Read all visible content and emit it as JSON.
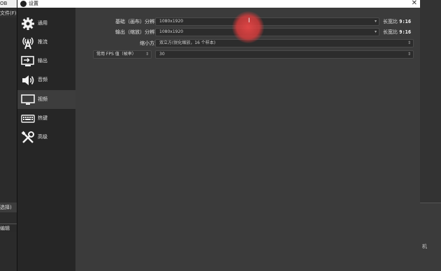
{
  "background": {
    "top_left_text": "OB",
    "menu_text": "文件(F)",
    "scene_text": "选择)",
    "edit_text": "编辑",
    "right_text": "机"
  },
  "dialog": {
    "title": "设置",
    "close_glyph": "✕"
  },
  "sidebar": {
    "items": [
      {
        "label": "通用",
        "icon": "gear-icon"
      },
      {
        "label": "推流",
        "icon": "broadcast-icon"
      },
      {
        "label": "输出",
        "icon": "output-icon"
      },
      {
        "label": "音频",
        "icon": "speaker-icon"
      },
      {
        "label": "视频",
        "icon": "monitor-icon",
        "active": true
      },
      {
        "label": "热键",
        "icon": "keyboard-icon"
      },
      {
        "label": "高级",
        "icon": "tools-icon"
      }
    ]
  },
  "video": {
    "base_resolution": {
      "label": "基础（画布）分辨率",
      "value": "1080x1920",
      "aspect_label": "长宽比",
      "aspect_value": "9:16"
    },
    "output_resolution": {
      "label": "输出（缩放）分辨率",
      "value": "1080x1920",
      "aspect_label": "长宽比",
      "aspect_value": "9:16"
    },
    "downscale_filter": {
      "label": "缩小方法",
      "value": "双立方(锐化缩放，16 个样本)"
    },
    "fps": {
      "label": "常用 FPS 值（帧率）",
      "value": "30"
    }
  },
  "colors": {
    "accent_highlight": "#e04848",
    "sidebar_bg": "#262626",
    "content_bg": "#3b3b3b"
  }
}
